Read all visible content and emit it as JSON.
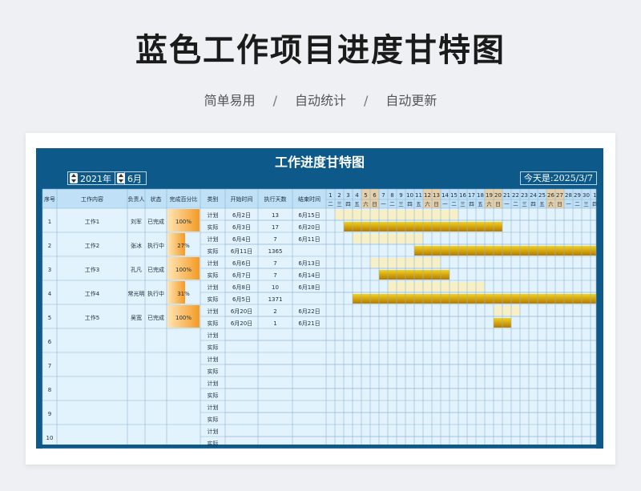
{
  "page": {
    "title": "蓝色工作项目进度甘特图",
    "subtitle": [
      "简单易用",
      "自动统计",
      "自动更新"
    ],
    "subtitle_sep": "/"
  },
  "sheet": {
    "title": "工作进度甘特图",
    "year": "2021年",
    "month": "6月",
    "today": "今天是:2025/3/7",
    "columns": [
      "序号",
      "工作内容",
      "负责人",
      "状态",
      "完成百分比",
      "类别",
      "开始时间",
      "执行天数",
      "结束时间"
    ],
    "day_numbers": [
      "1",
      "2",
      "3",
      "4",
      "5",
      "6",
      "7",
      "8",
      "9",
      "10",
      "11",
      "12",
      "13",
      "14",
      "15",
      "16",
      "17",
      "18",
      "19",
      "20",
      "21",
      "22",
      "23",
      "24",
      "25",
      "26",
      "27",
      "28",
      "29",
      "30",
      "1"
    ],
    "weekdays": [
      "二",
      "三",
      "四",
      "五",
      "六",
      "日",
      "一",
      "二",
      "三",
      "四",
      "五",
      "六",
      "日",
      "一",
      "二",
      "三",
      "四",
      "五",
      "六",
      "日",
      "一",
      "二",
      "三",
      "四",
      "五",
      "六",
      "日",
      "一",
      "二",
      "三",
      "四"
    ],
    "weekend_day_indices": [
      4,
      5,
      11,
      12,
      18,
      19,
      25,
      26
    ],
    "plan_label": "计划",
    "actual_label": "实际",
    "tasks": [
      {
        "no": "1",
        "name": "工作1",
        "owner": "刘军",
        "status": "已完成",
        "percent": "100%",
        "pct": 1.0,
        "plan": {
          "start": "6月2日",
          "days": "13",
          "end": "6月15日",
          "s": 2,
          "e": 15
        },
        "actual": {
          "start": "6月3日",
          "days": "17",
          "end": "6月20日",
          "s": 3,
          "e": 20
        }
      },
      {
        "no": "2",
        "name": "工作2",
        "owner": "张冰",
        "status": "执行中",
        "percent": "27%",
        "pct": 0.27,
        "plan": {
          "start": "6月4日",
          "days": "7",
          "end": "6月11日",
          "s": 4,
          "e": 11
        },
        "actual": {
          "start": "6月11日",
          "days": "1365",
          "end": "",
          "s": 11,
          "e": 31
        }
      },
      {
        "no": "3",
        "name": "工作3",
        "owner": "孔凡",
        "status": "已完成",
        "percent": "100%",
        "pct": 1.0,
        "plan": {
          "start": "6月6日",
          "days": "7",
          "end": "6月13日",
          "s": 6,
          "e": 13
        },
        "actual": {
          "start": "6月7日",
          "days": "7",
          "end": "6月14日",
          "s": 7,
          "e": 14
        }
      },
      {
        "no": "4",
        "name": "工作4",
        "owner": "常光明",
        "status": "执行中",
        "percent": "31%",
        "pct": 0.31,
        "plan": {
          "start": "6月8日",
          "days": "10",
          "end": "6月18日",
          "s": 8,
          "e": 18
        },
        "actual": {
          "start": "6月5日",
          "days": "1371",
          "end": "",
          "s": 4,
          "e": 31
        }
      },
      {
        "no": "5",
        "name": "工作5",
        "owner": "吴宽",
        "status": "已完成",
        "percent": "100%",
        "pct": 1.0,
        "plan": {
          "start": "6月20日",
          "days": "2",
          "end": "6月22日",
          "s": 20,
          "e": 22
        },
        "actual": {
          "start": "6月20日",
          "days": "1",
          "end": "6月21日",
          "s": 20,
          "e": 21
        }
      },
      {
        "no": "6"
      },
      {
        "no": "7"
      },
      {
        "no": "8"
      },
      {
        "no": "9"
      },
      {
        "no": "10"
      }
    ]
  },
  "colors": {
    "frame": "#0d5a8a",
    "header_bg": "#bfe0f7",
    "cell_bg": "#e3f3fd",
    "grid": "#8db4d2",
    "weekend_header": "#e7cfa8",
    "plan_bar": "#f7efc6",
    "actual_bar_light": "#f3d21c",
    "actual_bar_dark": "#b57a00",
    "pct_light": "#ffe5b4",
    "pct_dark": "#f59a23"
  }
}
